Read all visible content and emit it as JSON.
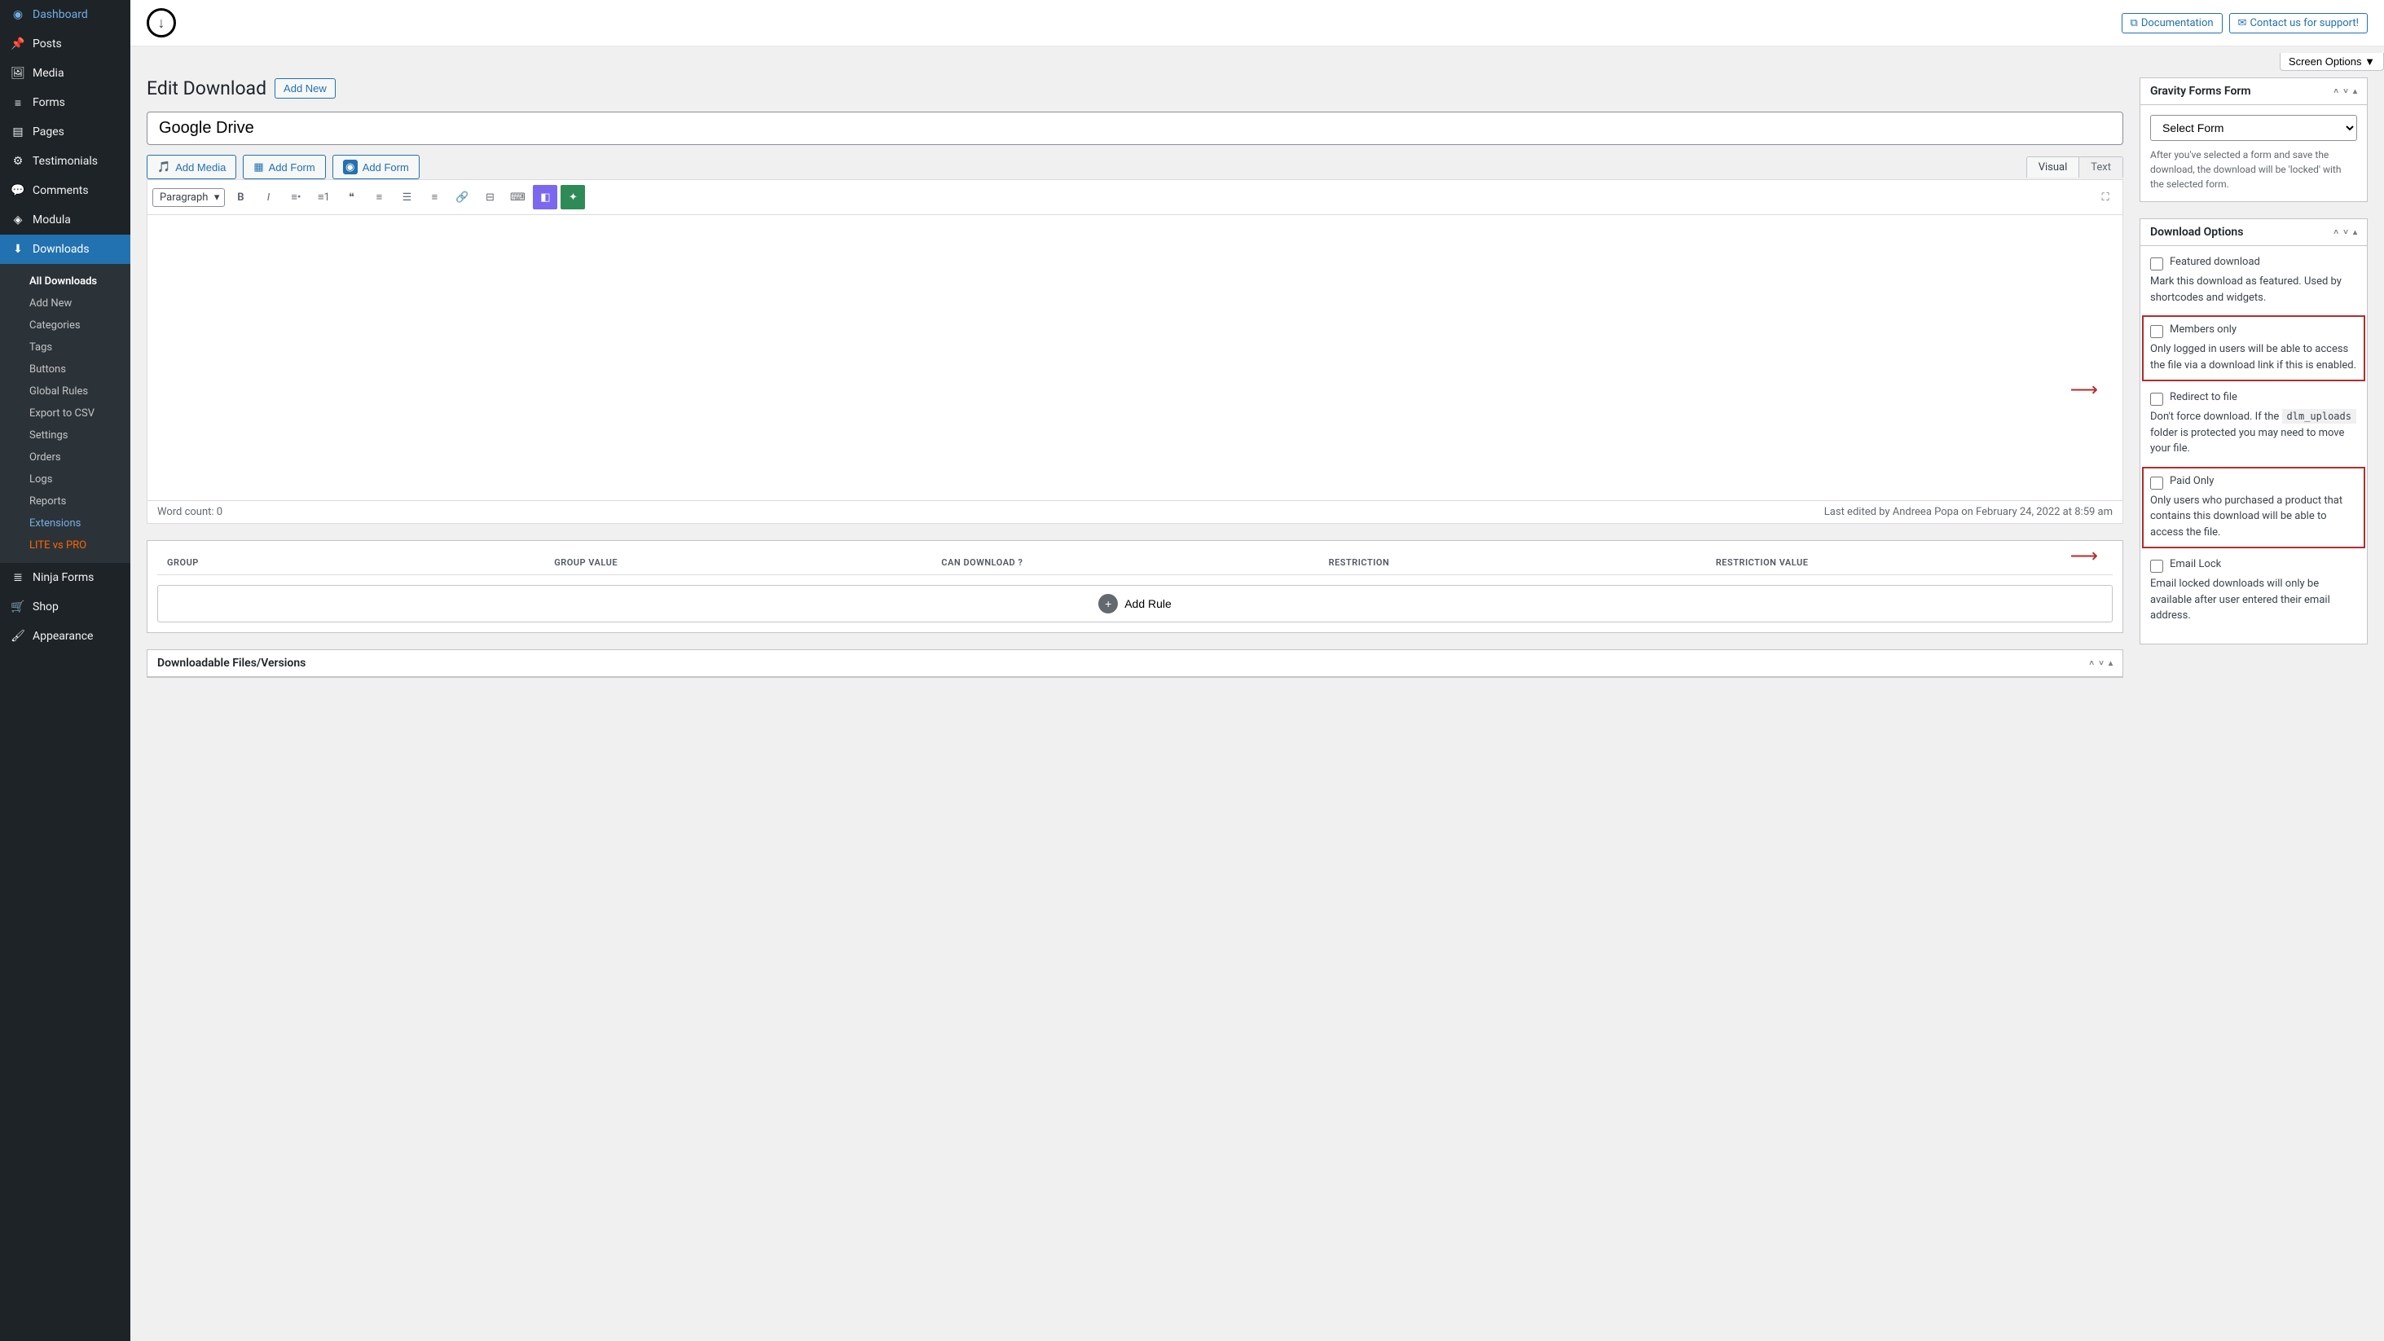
{
  "sidebar": {
    "items": [
      {
        "label": "Dashboard",
        "icon": "◉"
      },
      {
        "label": "Posts",
        "icon": "📌"
      },
      {
        "label": "Media",
        "icon": "🖼"
      },
      {
        "label": "Forms",
        "icon": "≡"
      },
      {
        "label": "Pages",
        "icon": "▤"
      },
      {
        "label": "Testimonials",
        "icon": "⚙"
      },
      {
        "label": "Comments",
        "icon": "💬"
      },
      {
        "label": "Modula",
        "icon": "◈"
      },
      {
        "label": "Downloads",
        "icon": "⬇",
        "current": true
      },
      {
        "label": "Ninja Forms",
        "icon": "≣"
      },
      {
        "label": "Shop",
        "icon": "🛒"
      },
      {
        "label": "Appearance",
        "icon": "🖌"
      }
    ],
    "submenu": [
      {
        "label": "All Downloads",
        "cls": "current-sub"
      },
      {
        "label": "Add New"
      },
      {
        "label": "Categories"
      },
      {
        "label": "Tags"
      },
      {
        "label": "Buttons"
      },
      {
        "label": "Global Rules"
      },
      {
        "label": "Export to CSV"
      },
      {
        "label": "Settings"
      },
      {
        "label": "Orders"
      },
      {
        "label": "Logs"
      },
      {
        "label": "Reports"
      },
      {
        "label": "Extensions",
        "cls": "ext"
      },
      {
        "label": "LITE vs PRO",
        "cls": "lite"
      }
    ]
  },
  "topbar": {
    "logo": "↓",
    "docs": "Documentation",
    "contact": "Contact us for support!"
  },
  "screen_options": "Screen Options ▼",
  "page": {
    "title": "Edit Download",
    "add_new": "Add New",
    "post_title": "Google Drive"
  },
  "editor": {
    "add_media": "Add Media",
    "add_form1": "Add Form",
    "add_form2": "Add Form",
    "tabs": {
      "visual": "Visual",
      "text": "Text"
    },
    "paragraph": "Paragraph",
    "word_count": "Word count: 0",
    "last_edited": "Last edited by Andreea Popa on February 24, 2022 at 8:59 am"
  },
  "rules": {
    "headers": [
      "GROUP",
      "GROUP VALUE",
      "CAN DOWNLOAD ?",
      "RESTRICTION",
      "RESTRICTION VALUE"
    ],
    "add_rule": "Add Rule"
  },
  "files_box": {
    "title": "Downloadable Files/Versions"
  },
  "gravity": {
    "title": "Gravity Forms Form",
    "select": "Select Form",
    "helper": "After you've selected a form and save the download, the download will be 'locked' with the selected form."
  },
  "download_options": {
    "title": "Download Options",
    "featured": {
      "label": "Featured download",
      "desc": "Mark this download as featured. Used by shortcodes and widgets."
    },
    "members": {
      "label": "Members only",
      "desc": "Only logged in users will be able to access the file via a download link if this is enabled."
    },
    "redirect": {
      "label": "Redirect to file",
      "desc_pre": "Don't force download. If the ",
      "code": "dlm_uploads",
      "desc_post": " folder is protected you may need to move your file."
    },
    "paid": {
      "label": "Paid Only",
      "desc": "Only users who purchased a product that contains this download will be able to access the file."
    },
    "email": {
      "label": "Email Lock",
      "desc": "Email locked downloads will only be available after user entered their email address."
    }
  }
}
